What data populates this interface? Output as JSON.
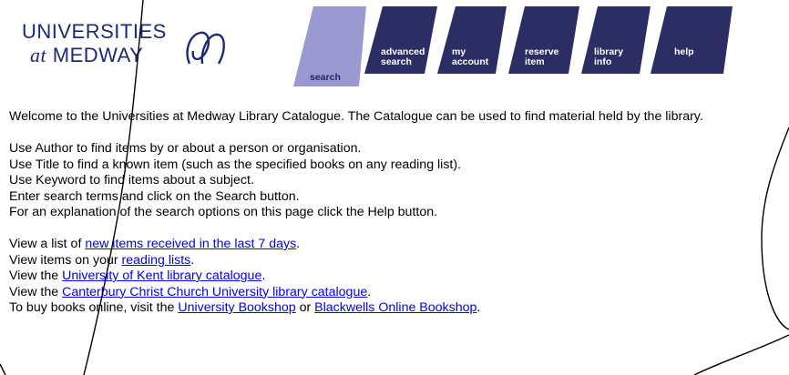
{
  "logo": {
    "line1": "UNIVERSITIES",
    "line2_at": "at",
    "line2_name": "MEDWAY"
  },
  "tabs": [
    {
      "key": "search",
      "line1": "search",
      "line2": "",
      "active": true
    },
    {
      "key": "advanced",
      "line1": "advanced",
      "line2": "search",
      "active": false
    },
    {
      "key": "account",
      "line1": "my",
      "line2": "account",
      "active": false
    },
    {
      "key": "reserve",
      "line1": "reserve",
      "line2": "item",
      "active": false
    },
    {
      "key": "libinfo",
      "line1": "library",
      "line2": "info",
      "active": false
    },
    {
      "key": "help",
      "line1": "help",
      "line2": "",
      "active": false
    }
  ],
  "colors": {
    "tab_inactive": "#2c2e63",
    "tab_active": "#9a9ad0",
    "link": "#0000ee"
  },
  "intro": {
    "welcome": "Welcome to the Universities at Medway Library Catalogue. The Catalogue can be used to find material held by the library."
  },
  "instructions": [
    "Use Author to find items by or about a person or organisation.",
    "Use Title to find a known item (such as the specified books on any reading list).",
    "Use Keyword to find items about a subject.",
    "Enter search terms and click on the Search button.",
    "For an explanation of the search options on this page click the Help button."
  ],
  "links": {
    "new_items": {
      "before": "View a list of ",
      "link": "new items received in the last 7 days",
      "after": "."
    },
    "reading_lists": {
      "before": "View items on your ",
      "link": "reading lists",
      "after": "."
    },
    "kent": {
      "before": "View the ",
      "link": "University of Kent library catalogue",
      "after": "."
    },
    "ccc": {
      "before": "View the ",
      "link": "Canterbury Christ Church University library catalogue",
      "after": "."
    },
    "books": {
      "before": "To buy books online, visit the ",
      "link1": "University Bookshop",
      "middle": " or ",
      "link2": "Blackwells Online Bookshop",
      "after": "."
    }
  }
}
